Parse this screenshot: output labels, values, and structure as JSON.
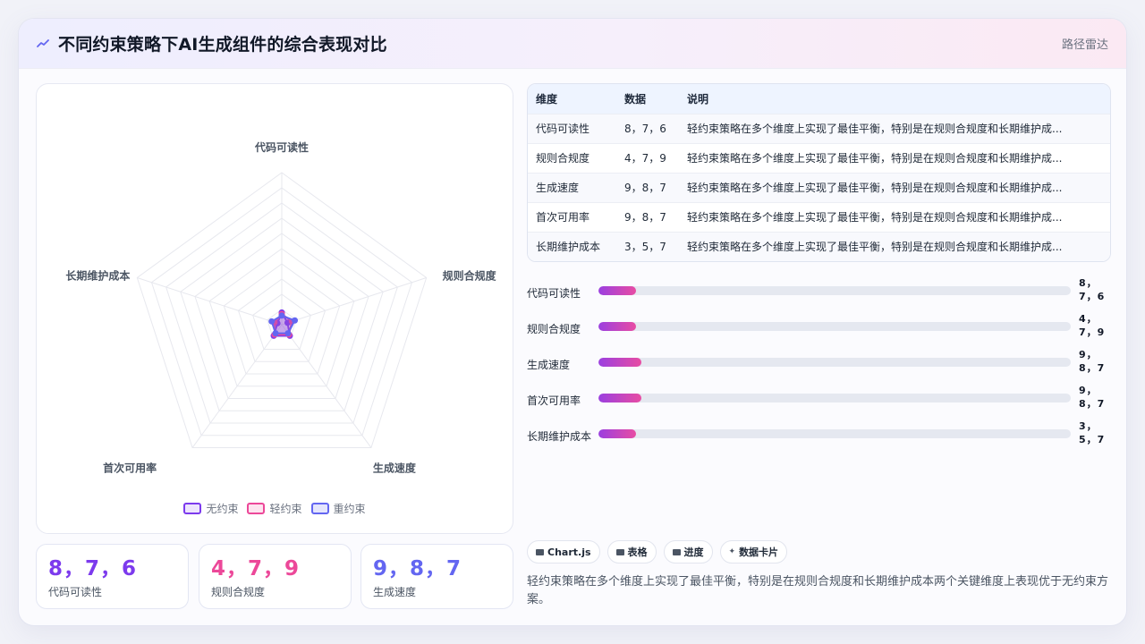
{
  "header": {
    "title": "不同约束策略下AI生成组件的综合表现对比",
    "subtitle": "路径雷达",
    "icon": "chart-line-icon"
  },
  "radar": {
    "axes": [
      "代码可读性",
      "规则合规度",
      "生成速度",
      "首次可用率",
      "长期维护成本"
    ],
    "max": 100,
    "series": [
      {
        "name": "无约束",
        "values": [
          8,
          4,
          9,
          9,
          3
        ],
        "color": "#7c3aed"
      },
      {
        "name": "轻约束",
        "values": [
          7,
          7,
          8,
          8,
          5
        ],
        "color": "#ec4899"
      },
      {
        "name": "重约束",
        "values": [
          6,
          9,
          7,
          7,
          7
        ],
        "color": "#6366f1"
      }
    ]
  },
  "stats": [
    {
      "value": "8，7，6",
      "label": "代码可读性",
      "color": "#7c3aed"
    },
    {
      "value": "4，7，9",
      "label": "规则合规度",
      "color": "#ec4899"
    },
    {
      "value": "9，8，7",
      "label": "生成速度",
      "color": "#6366f1"
    }
  ],
  "table": {
    "headers": [
      "维度",
      "数据",
      "说明"
    ],
    "rows": [
      [
        "代码可读性",
        "8，7，6",
        "轻约束策略在多个维度上实现了最佳平衡，特别是在规则合规度和长期维护成..."
      ],
      [
        "规则合规度",
        "4，7，9",
        "轻约束策略在多个维度上实现了最佳平衡，特别是在规则合规度和长期维护成..."
      ],
      [
        "生成速度",
        "9，8，7",
        "轻约束策略在多个维度上实现了最佳平衡，特别是在规则合规度和长期维护成..."
      ],
      [
        "首次可用率",
        "9，8，7",
        "轻约束策略在多个维度上实现了最佳平衡，特别是在规则合规度和长期维护成..."
      ],
      [
        "长期维护成本",
        "3，5，7",
        "轻约束策略在多个维度上实现了最佳平衡，特别是在规则合规度和长期维护成..."
      ]
    ]
  },
  "bars": [
    {
      "label": "代码可读性",
      "value_line1": "8，",
      "value_line2": "7，6",
      "fill_fraction": 0.08
    },
    {
      "label": "规则合规度",
      "value_line1": "4，",
      "value_line2": "7，9",
      "fill_fraction": 0.08
    },
    {
      "label": "生成速度",
      "value_line1": "9，",
      "value_line2": "8，7",
      "fill_fraction": 0.09
    },
    {
      "label": "首次可用率",
      "value_line1": "9，",
      "value_line2": "8，7",
      "fill_fraction": 0.09
    },
    {
      "label": "长期维护成本",
      "value_line1": "3，",
      "value_line2": "5，7",
      "fill_fraction": 0.08
    }
  ],
  "tags": [
    {
      "label": "Chart.js",
      "icon": "chart-icon"
    },
    {
      "label": "表格",
      "icon": "table-icon"
    },
    {
      "label": "进度",
      "icon": "progress-icon"
    },
    {
      "label": "数据卡片",
      "icon": "sparkle-icon"
    }
  ],
  "summary": "轻约束策略在多个维度上实现了最佳平衡，特别是在规则合规度和长期维护成本两个关键维度上表现优于无约束方案。"
}
